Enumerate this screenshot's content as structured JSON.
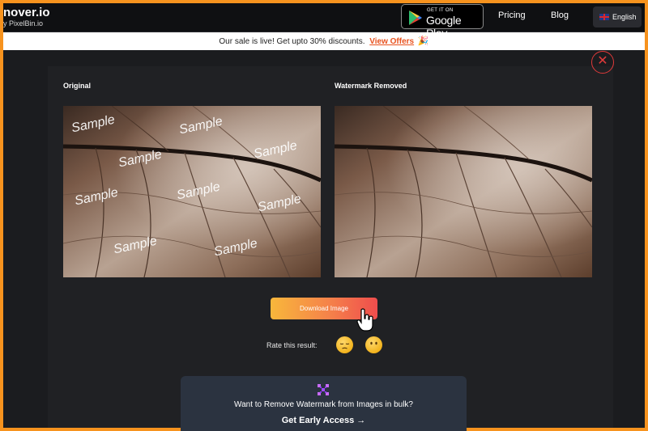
{
  "nav": {
    "brand_name": "nover.io",
    "brand_sub": "y PixelBin.io",
    "store_small": "GET IT ON",
    "store_big": "Google Play",
    "pricing": "Pricing",
    "blog": "Blog",
    "language": "English"
  },
  "banner": {
    "text": "Our sale is live! Get upto 30% discounts.",
    "link": "View Offers",
    "icon": "🎉"
  },
  "modal": {
    "close": "✕",
    "original_title": "Original",
    "result_title": "Watermark Removed",
    "watermark": "Sample",
    "download": "Download Image",
    "rate_label": "Rate this result:",
    "bulk_text": "Want to Remove Watermark from Images in bulk?",
    "bulk_cta": "Get Early Access →"
  },
  "colors": {
    "frame_border": "#f7931e",
    "accent_link": "#e8521e",
    "close": "#e03a3a",
    "modal_bg": "#202124",
    "bulk_bg": "#2b3340"
  },
  "icons": {
    "store": "google-play-icon",
    "flag": "uk-flag-icon",
    "close": "close-icon",
    "cursor": "hand-pointer-icon",
    "rating_sad": "pensive-face-icon",
    "rating_neutral": "neutral-face-icon",
    "bulk": "pixelbin-logo-icon"
  }
}
